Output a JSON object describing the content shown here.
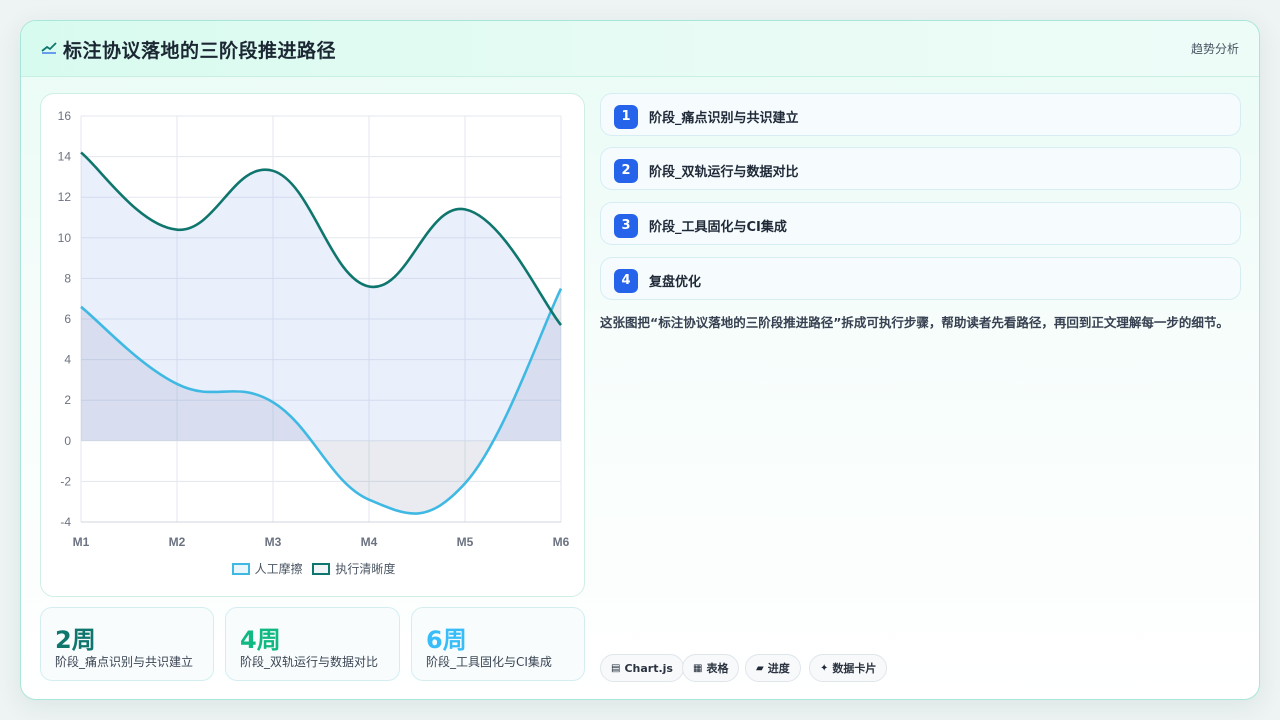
{
  "header": {
    "title": "标注协议落地的三阶段推进路径",
    "tag": "趋势分析",
    "logo_icon": "chart-line-icon"
  },
  "chart_data": {
    "type": "line",
    "categories": [
      "M1",
      "M2",
      "M3",
      "M4",
      "M5",
      "M6"
    ],
    "ylim": [
      -4,
      16
    ],
    "yticks": [
      "16",
      "14",
      "12",
      "10",
      "8",
      "6",
      "4",
      "2",
      "0",
      "-2",
      "-4"
    ],
    "grid": true,
    "legend_position": "bottom",
    "series": [
      {
        "name": "人工摩擦",
        "values": [
          6.6,
          2.8,
          1.9,
          -2.9,
          -2.1,
          7.5
        ],
        "color": "#3fb9e3",
        "fill": true
      },
      {
        "name": "执行清晰度",
        "values": [
          14.2,
          10.4,
          13.3,
          7.6,
          11.4,
          5.7
        ],
        "color": "#0f766e",
        "fill": true
      }
    ]
  },
  "legend": {
    "series_a": "人工摩擦",
    "series_b": "执行清晰度"
  },
  "stats": [
    {
      "value": "2周",
      "label": "阶段_痛点识别与共识建立",
      "color": "#0f766e"
    },
    {
      "value": "4周",
      "label": "阶段_双轨运行与数据对比",
      "color": "#10b981"
    },
    {
      "value": "6周",
      "label": "阶段_工具固化与CI集成",
      "color": "#38bdf8"
    }
  ],
  "steps": [
    {
      "num": "1",
      "text": "阶段_痛点识别与共识建立"
    },
    {
      "num": "2",
      "text": "阶段_双轨运行与数据对比"
    },
    {
      "num": "3",
      "text": "阶段_工具固化与CI集成"
    },
    {
      "num": "4",
      "text": "复盘优化"
    }
  ],
  "description": "这张图把“标注协议落地的三阶段推进路径”拆成可执行步骤，帮助读者先看路径，再回到正文理解每一步的细节。",
  "pills": [
    {
      "icon": "chart-icon",
      "glyph": "▤",
      "label": "Chart.js"
    },
    {
      "icon": "table-icon",
      "glyph": "▦",
      "label": "表格"
    },
    {
      "icon": "progress-icon",
      "glyph": "▰",
      "label": "进度"
    },
    {
      "icon": "sparkle-icon",
      "glyph": "✦",
      "label": "数据卡片"
    }
  ]
}
